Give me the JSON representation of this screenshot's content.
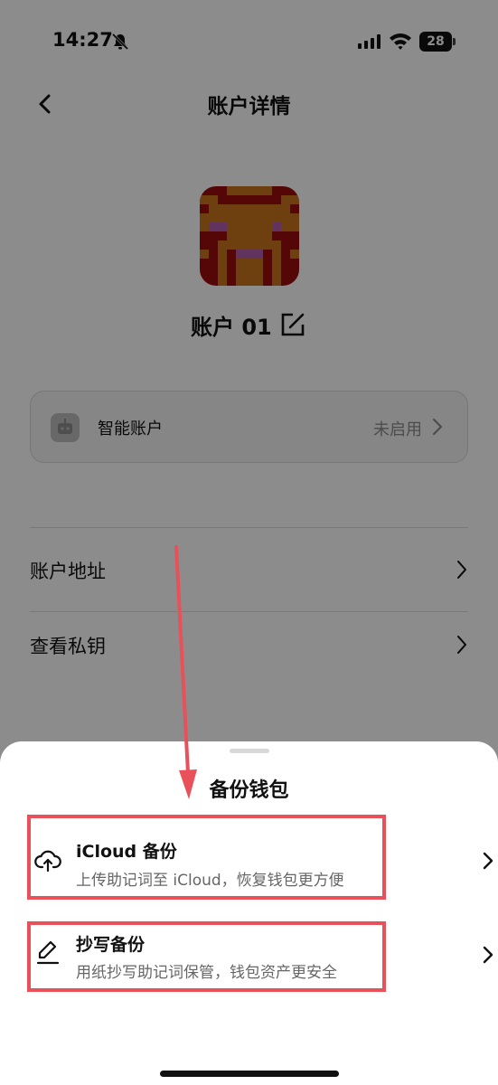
{
  "status_bar": {
    "time": "14:27",
    "battery": "28"
  },
  "header": {
    "title": "账户详情"
  },
  "account": {
    "name": "账户 01"
  },
  "smart_account": {
    "label": "智能账户",
    "status": "未启用"
  },
  "menu": [
    {
      "label": "账户地址"
    },
    {
      "label": "查看私钥"
    }
  ],
  "sheet": {
    "title": "备份钱包",
    "options": [
      {
        "title": "iCloud 备份",
        "subtitle": "上传助记词至 iCloud，恢复钱包更方便",
        "icon": "cloud-upload-icon"
      },
      {
        "title": "抄写备份",
        "subtitle": "用纸抄写助记词保管，钱包资产更安全",
        "icon": "pen-icon"
      }
    ]
  },
  "colors": {
    "highlight": "#e8515a",
    "avatar_red": "#9b0d10",
    "avatar_orange": "#c9741c",
    "avatar_pink": "#b55eb0"
  }
}
